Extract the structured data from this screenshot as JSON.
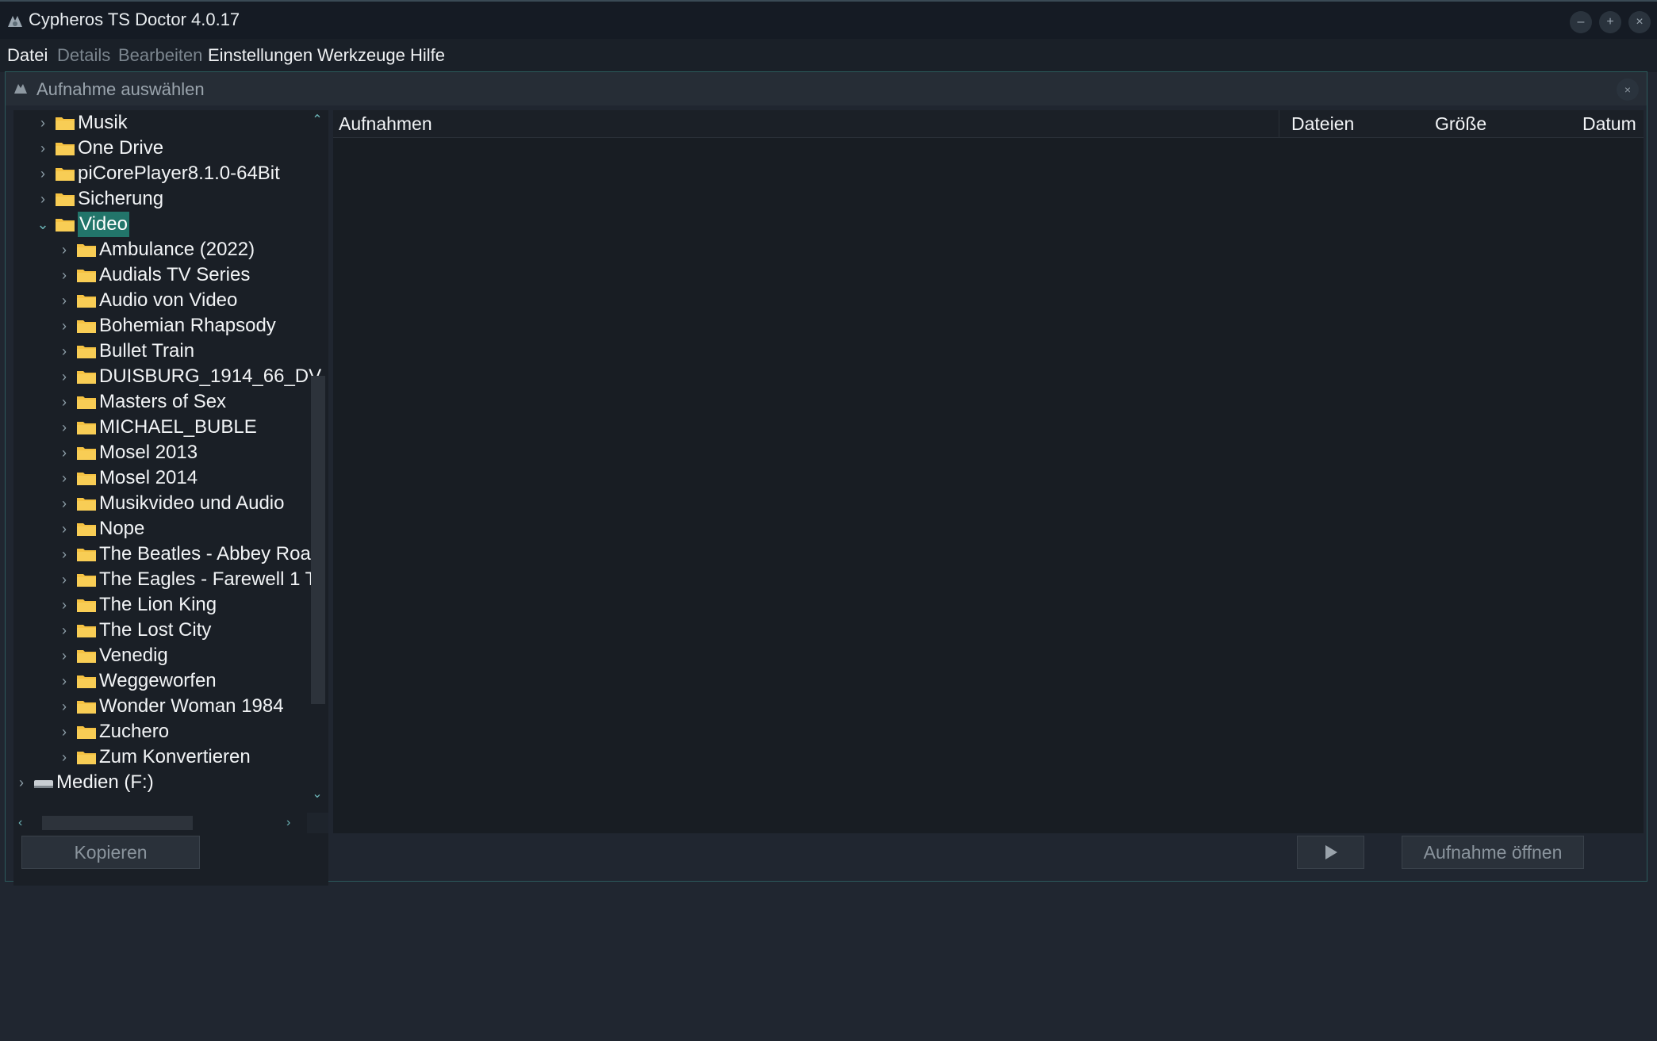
{
  "window": {
    "title": "Cypheros TS Doctor 4.0.17"
  },
  "window_controls": {
    "minimize": "–",
    "maximize": "+",
    "close": "×"
  },
  "menu": [
    {
      "label": "Datei",
      "enabled": true
    },
    {
      "label": "Details",
      "enabled": false
    },
    {
      "label": "Bearbeiten",
      "enabled": false
    },
    {
      "label": "Einstellungen",
      "enabled": true
    },
    {
      "label": "Werkzeuge",
      "enabled": true
    },
    {
      "label": "Hilfe",
      "enabled": true
    }
  ],
  "dialog": {
    "title": "Aufnahme auswählen",
    "close": "×"
  },
  "tree": {
    "items": [
      {
        "label": "Musik",
        "level": 1,
        "expanded": false,
        "selected": false,
        "icon": "folder-icon"
      },
      {
        "label": "One Drive",
        "level": 1,
        "expanded": false,
        "selected": false,
        "icon": "folder-icon"
      },
      {
        "label": "piCorePlayer8.1.0-64Bit",
        "level": 1,
        "expanded": false,
        "selected": false,
        "icon": "folder-icon"
      },
      {
        "label": "Sicherung",
        "level": 1,
        "expanded": false,
        "selected": false,
        "icon": "folder-icon"
      },
      {
        "label": "Video",
        "level": 1,
        "expanded": true,
        "selected": true,
        "icon": "folder-icon"
      },
      {
        "label": "Ambulance (2022)",
        "level": 2,
        "expanded": false,
        "selected": false,
        "icon": "folder-icon"
      },
      {
        "label": "Audials TV Series",
        "level": 2,
        "expanded": false,
        "selected": false,
        "icon": "folder-icon"
      },
      {
        "label": "Audio von Video",
        "level": 2,
        "expanded": false,
        "selected": false,
        "icon": "folder-icon"
      },
      {
        "label": "Bohemian Rhapsody",
        "level": 2,
        "expanded": false,
        "selected": false,
        "icon": "folder-icon"
      },
      {
        "label": "Bullet Train",
        "level": 2,
        "expanded": false,
        "selected": false,
        "icon": "folder-icon"
      },
      {
        "label": "DUISBURG_1914_66_DV",
        "level": 2,
        "expanded": false,
        "selected": false,
        "icon": "folder-icon"
      },
      {
        "label": "Masters of Sex",
        "level": 2,
        "expanded": false,
        "selected": false,
        "icon": "folder-icon"
      },
      {
        "label": "MICHAEL_BUBLE",
        "level": 2,
        "expanded": false,
        "selected": false,
        "icon": "folder-icon"
      },
      {
        "label": "Mosel 2013",
        "level": 2,
        "expanded": false,
        "selected": false,
        "icon": "folder-icon"
      },
      {
        "label": "Mosel 2014",
        "level": 2,
        "expanded": false,
        "selected": false,
        "icon": "folder-icon"
      },
      {
        "label": "Musikvideo und Audio",
        "level": 2,
        "expanded": false,
        "selected": false,
        "icon": "folder-icon"
      },
      {
        "label": "Nope",
        "level": 2,
        "expanded": false,
        "selected": false,
        "icon": "folder-icon"
      },
      {
        "label": "The Beatles - Abbey Roa",
        "level": 2,
        "expanded": false,
        "selected": false,
        "icon": "folder-icon"
      },
      {
        "label": "The Eagles - Farewell 1 T",
        "level": 2,
        "expanded": false,
        "selected": false,
        "icon": "folder-icon"
      },
      {
        "label": "The Lion King",
        "level": 2,
        "expanded": false,
        "selected": false,
        "icon": "folder-icon"
      },
      {
        "label": "The Lost City",
        "level": 2,
        "expanded": false,
        "selected": false,
        "icon": "folder-icon"
      },
      {
        "label": "Venedig",
        "level": 2,
        "expanded": false,
        "selected": false,
        "icon": "folder-icon"
      },
      {
        "label": "Weggeworfen",
        "level": 2,
        "expanded": false,
        "selected": false,
        "icon": "folder-icon"
      },
      {
        "label": "Wonder Woman 1984",
        "level": 2,
        "expanded": false,
        "selected": false,
        "icon": "folder-icon"
      },
      {
        "label": "Zuchero",
        "level": 2,
        "expanded": false,
        "selected": false,
        "icon": "folder-icon"
      },
      {
        "label": "Zum Konvertieren",
        "level": 2,
        "expanded": false,
        "selected": false,
        "icon": "folder-icon"
      },
      {
        "label": "Medien (F:)",
        "level": 0,
        "expanded": false,
        "selected": false,
        "icon": "drive-icon"
      }
    ]
  },
  "list": {
    "columns": [
      "Aufnahmen",
      "Dateien",
      "Größe",
      "Datum"
    ],
    "rows": []
  },
  "buttons": {
    "copy": "Kopieren",
    "play_icon": "play-icon",
    "open": "Aufnahme öffnen"
  },
  "colors": {
    "background": "#202630",
    "selection": "#22756a",
    "accent": "#6bb3b5",
    "folder": "#f5c242"
  }
}
